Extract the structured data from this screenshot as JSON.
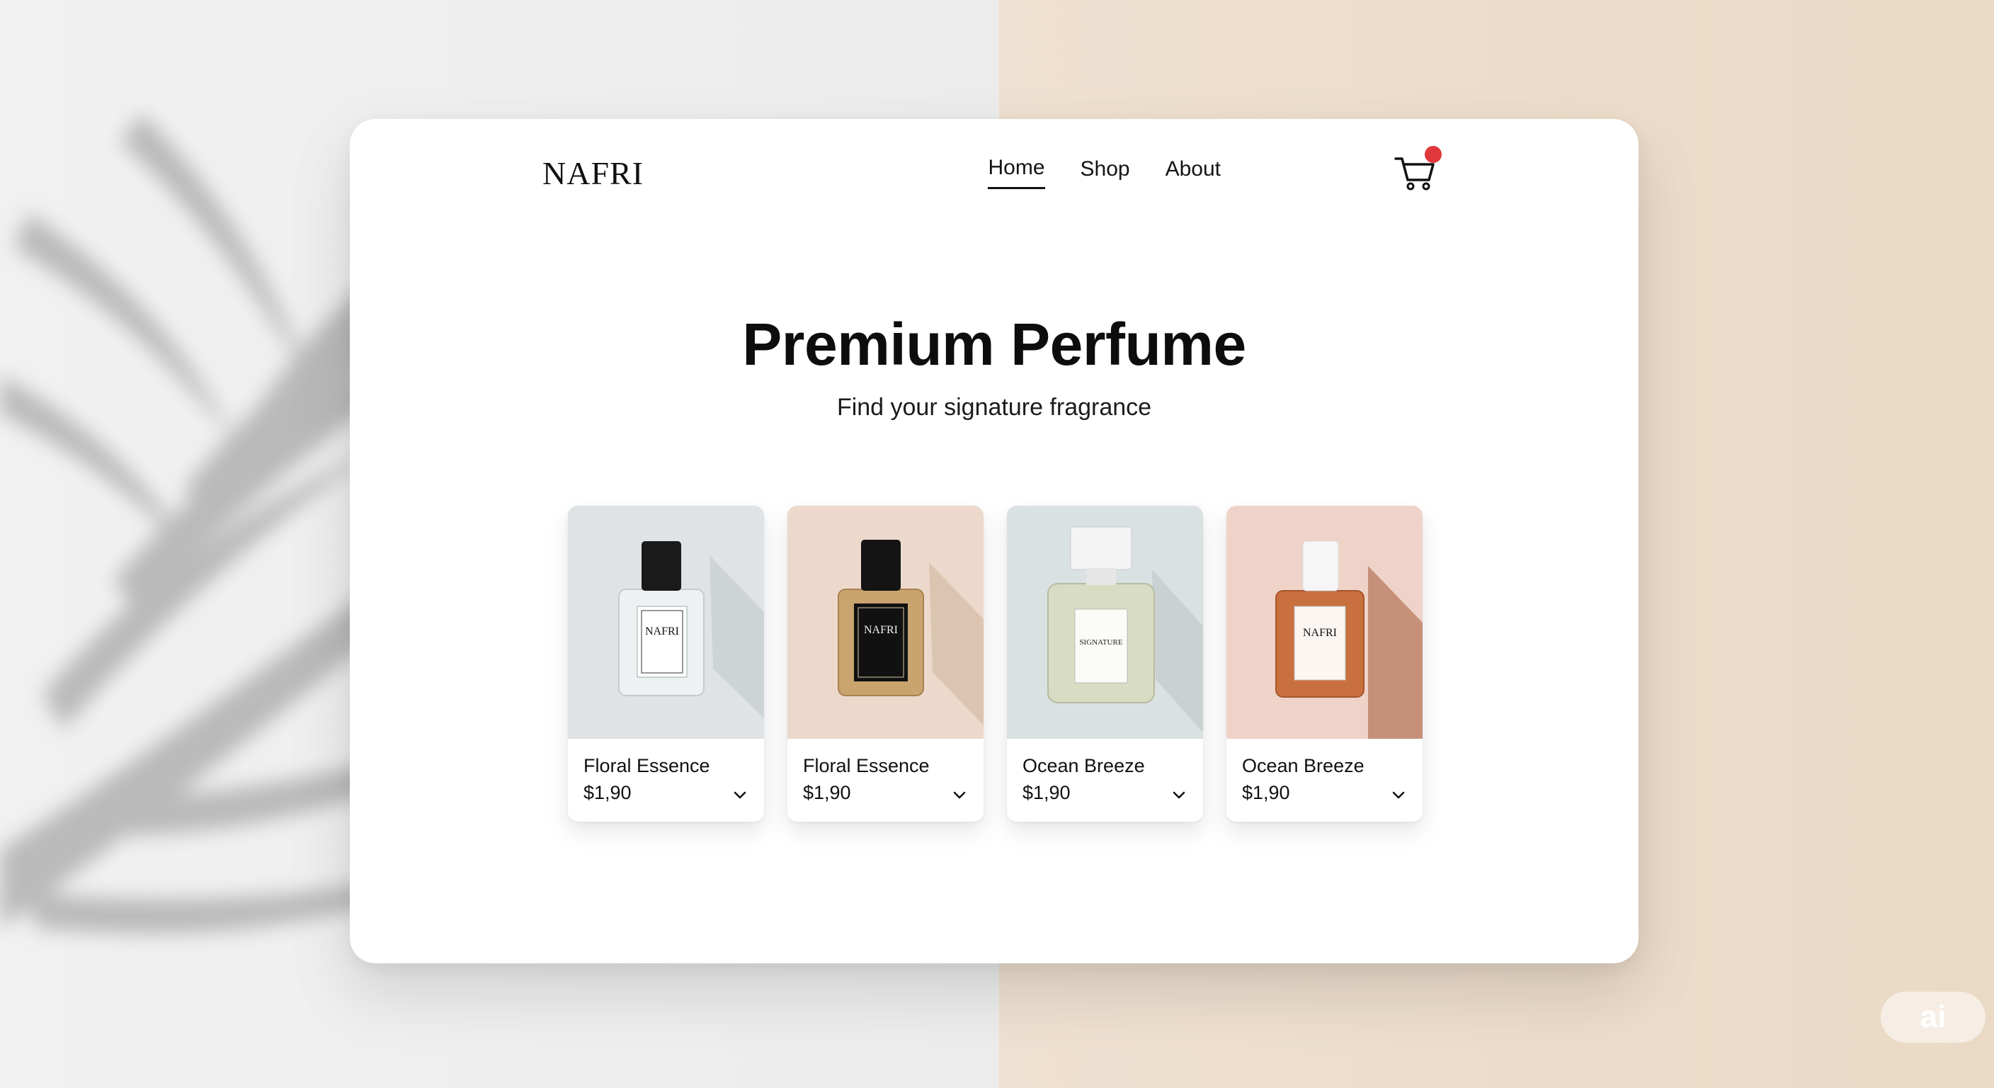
{
  "brand": {
    "logo_text": "NAFRI"
  },
  "nav": {
    "items": [
      {
        "label": "Home",
        "active": true
      },
      {
        "label": "Shop",
        "active": false
      },
      {
        "label": "About",
        "active": false
      }
    ],
    "cart_icon": "shopping-cart-icon",
    "cart_badge_color": "#e0383a"
  },
  "hero": {
    "title": "Premium Perfume",
    "subtitle": "Find your signature fragrance"
  },
  "products": [
    {
      "name": "Floral Essence",
      "price": "$1,90",
      "bottle_label": "NAFRI",
      "image_bg": "#dfe3e5",
      "liquid": "#eef1f2",
      "cap": "#1a1a1a",
      "chevron_icon": "chevron-down-icon"
    },
    {
      "name": "Floral Essence",
      "price": "$1,90",
      "bottle_label": "NAFRI",
      "image_bg": "#ecd9cc",
      "liquid": "#c9a46e",
      "cap": "#141414",
      "chevron_icon": "chevron-down-icon"
    },
    {
      "name": "Ocean Breeze",
      "price": "$1,90",
      "bottle_label": "SIGNATURE",
      "image_bg": "#d9e1e2",
      "liquid": "#d7dcc2",
      "cap": "#f4f4f4",
      "chevron_icon": "chevron-down-icon"
    },
    {
      "name": "Ocean Breeze",
      "price": "$1,90",
      "bottle_label": "NAFRI",
      "image_bg": "#f0d3c8",
      "liquid": "#c9703f",
      "cap": "#f6f6f6",
      "chevron_icon": "chevron-down-icon"
    }
  ],
  "corner_badge": {
    "text": "ai"
  },
  "colors": {
    "accent": "#111111",
    "background_left": "#ececec",
    "background_right": "#ead9c5"
  }
}
